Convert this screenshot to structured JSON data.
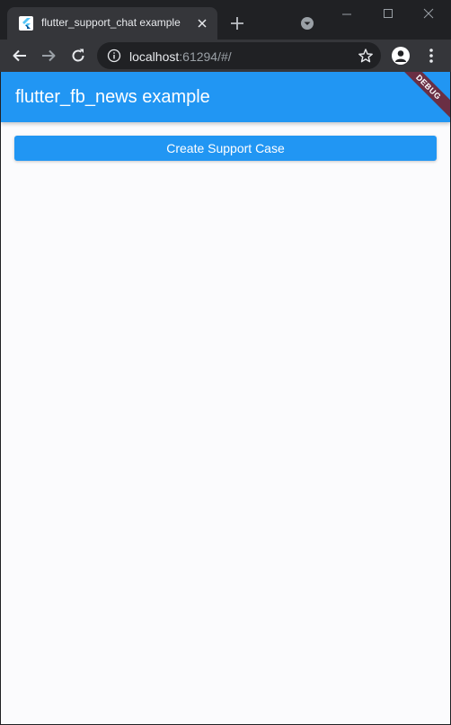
{
  "browser": {
    "tab": {
      "title": "flutter_support_chat example",
      "favicon": "flutter-icon"
    },
    "address": {
      "host": "localhost",
      "rest": ":61294/#/"
    },
    "icons": {
      "close": "close-icon",
      "new_tab": "plus-icon",
      "tab_search": "chevron-down-icon",
      "back": "back-arrow-icon",
      "forward": "forward-arrow-icon",
      "reload": "reload-icon",
      "info": "info-icon",
      "star": "star-icon",
      "profile": "profile-icon",
      "menu": "kebab-menu-icon",
      "minimize": "minimize-icon",
      "maximize": "maximize-icon",
      "window_close": "window-close-icon"
    }
  },
  "app": {
    "appbar_title": "flutter_fb_news example",
    "debug_banner": "DEBUG",
    "create_button_label": "Create Support Case"
  },
  "colors": {
    "primary": "#2196f3",
    "debug_banner": "#771d24",
    "page_background": "#fbfbfd",
    "browser_frame": "#202124",
    "browser_toolbar": "#35363a"
  }
}
